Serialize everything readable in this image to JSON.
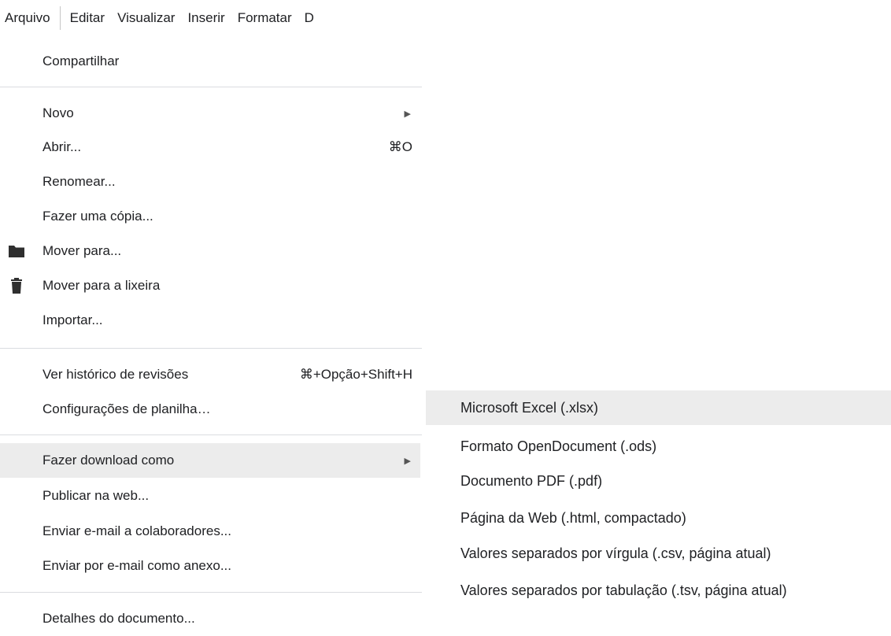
{
  "menubar": {
    "items": [
      "Arquivo",
      "Editar",
      "Visualizar",
      "Inserir",
      "Formatar",
      "D"
    ]
  },
  "file_menu": {
    "share": "Compartilhar",
    "new": "Novo",
    "open": "Abrir...",
    "open_shortcut": "⌘O",
    "rename": "Renomear...",
    "make_copy": "Fazer uma cópia...",
    "move_to": "Mover para...",
    "move_to_trash": "Mover para a lixeira",
    "import": "Importar...",
    "version_history": "Ver histórico de revisões",
    "version_history_shortcut": "⌘+Opção+Shift+H",
    "spreadsheet_settings": "Configurações de planilha…",
    "download_as": "Fazer download como",
    "publish_web": "Publicar na web...",
    "email_collaborators": "Enviar e-mail a colaboradores...",
    "email_attachment": "Enviar por e-mail como anexo...",
    "document_details": "Detalhes do documento..."
  },
  "download_submenu": {
    "items": [
      "Microsoft Excel (.xlsx)",
      "Formato OpenDocument (.ods)",
      "Documento PDF (.pdf)",
      "Página da Web (.html, compactado)",
      "Valores separados por vírgula (.csv, página atual)",
      "Valores separados por tabulação (.tsv, página atual)"
    ]
  },
  "icons": {
    "submenu_arrow": "▶",
    "folder": "folder-icon",
    "trash": "trash-icon"
  },
  "colors": {
    "highlight": "#ececec",
    "separator": "#dadce0",
    "text": "#202124"
  }
}
